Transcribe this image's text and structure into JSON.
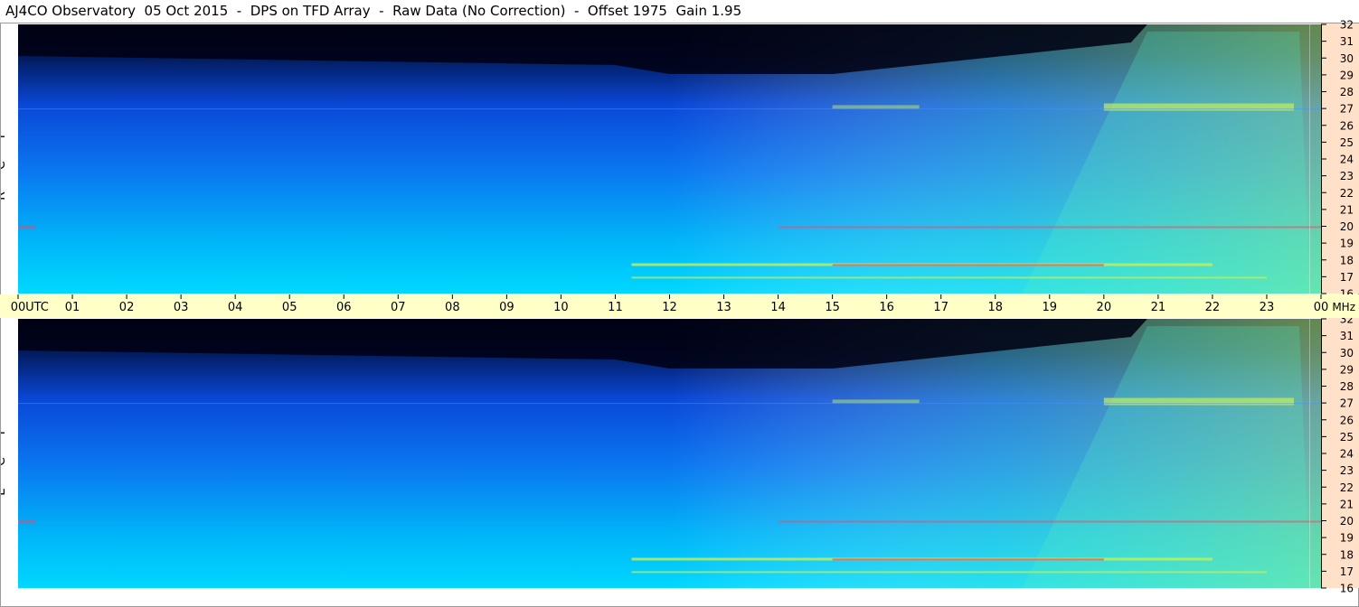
{
  "title": "AJ4CO Observatory  05 Oct 2015  -  DPS on TFD Array  -  Raw Data (No Correction)  -  Offset 1975  Gain 1.95",
  "panels": [
    {
      "label_letters": [
        "R",
        "C",
        "P"
      ]
    },
    {
      "label_letters": [
        "L",
        "C",
        "P"
      ]
    }
  ],
  "colors": {
    "time_bar": "#ffffc8",
    "freq_axis": "#ffe0c8",
    "spectrogram_low": "#000a26",
    "spectrogram_mid": "#0a5cff",
    "spectrogram_high": "#00d8ff",
    "emission": "#c8f050",
    "interference": "#ff4060"
  },
  "chart_data": {
    "type": "heatmap",
    "title": "AJ4CO Observatory  05 Oct 2015  -  DPS on TFD Array  -  Raw Data (No Correction)  -  Offset 1975  Gain 1.95",
    "x_unit_label": "UTC",
    "y_unit_label": "MHz",
    "x_tick_labels": [
      "00",
      "01",
      "02",
      "03",
      "04",
      "05",
      "06",
      "07",
      "08",
      "09",
      "10",
      "11",
      "12",
      "13",
      "14",
      "15",
      "16",
      "17",
      "18",
      "19",
      "20",
      "21",
      "22",
      "23",
      "00"
    ],
    "x_range_hours": [
      0,
      24
    ],
    "y_tick_labels": [
      "32",
      "31",
      "30",
      "29",
      "28",
      "27",
      "26",
      "25",
      "24",
      "23",
      "22",
      "21",
      "20",
      "19",
      "18",
      "17",
      "16"
    ],
    "y_range_mhz": [
      16,
      32
    ],
    "series": [
      {
        "name": "RCP"
      },
      {
        "name": "LCP"
      }
    ]
  }
}
